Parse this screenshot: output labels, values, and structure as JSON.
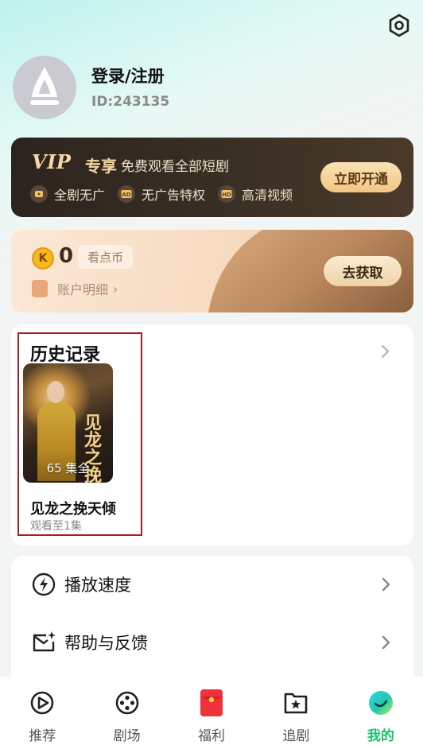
{
  "header": {
    "login_label": "登录/注册",
    "user_id": "ID:243135",
    "settings_icon": "gear-icon"
  },
  "vip": {
    "logo_vip": "VIP",
    "logo_exclusive": "专享",
    "description": "免费观看全部短剧",
    "features": [
      {
        "icon": "play-icon",
        "label": "全剧无广"
      },
      {
        "icon": "ad-icon",
        "label": "无广告特权"
      },
      {
        "icon": "hd-icon",
        "label": "高清视频"
      }
    ],
    "open_button": "立即开通",
    "accent_color": "#f6d7a4"
  },
  "coins": {
    "amount": "0",
    "unit": "看点币",
    "account_detail": "账户明细",
    "get_button": "去获取"
  },
  "history": {
    "title": "历史记录",
    "items": [
      {
        "title": "见龙之挽天倾",
        "episodes": "65 集全",
        "progress": "观看至1集",
        "poster_text": "见龙之挽"
      }
    ]
  },
  "settings": {
    "rows": [
      {
        "icon": "lightning-icon",
        "label": "播放速度"
      },
      {
        "icon": "mail-sparkle-icon",
        "label": "帮助与反馈"
      }
    ]
  },
  "bottom_nav": {
    "items": [
      {
        "icon": "play-circle-icon",
        "label": "推荐",
        "active": false
      },
      {
        "icon": "film-reel-icon",
        "label": "剧场",
        "active": false
      },
      {
        "icon": "red-envelope-icon",
        "label": "福利",
        "active": false
      },
      {
        "icon": "bookmark-star-icon",
        "label": "追剧",
        "active": false
      },
      {
        "icon": "profile-icon",
        "label": "我的",
        "active": true
      }
    ],
    "active_color": "#18c46a"
  }
}
